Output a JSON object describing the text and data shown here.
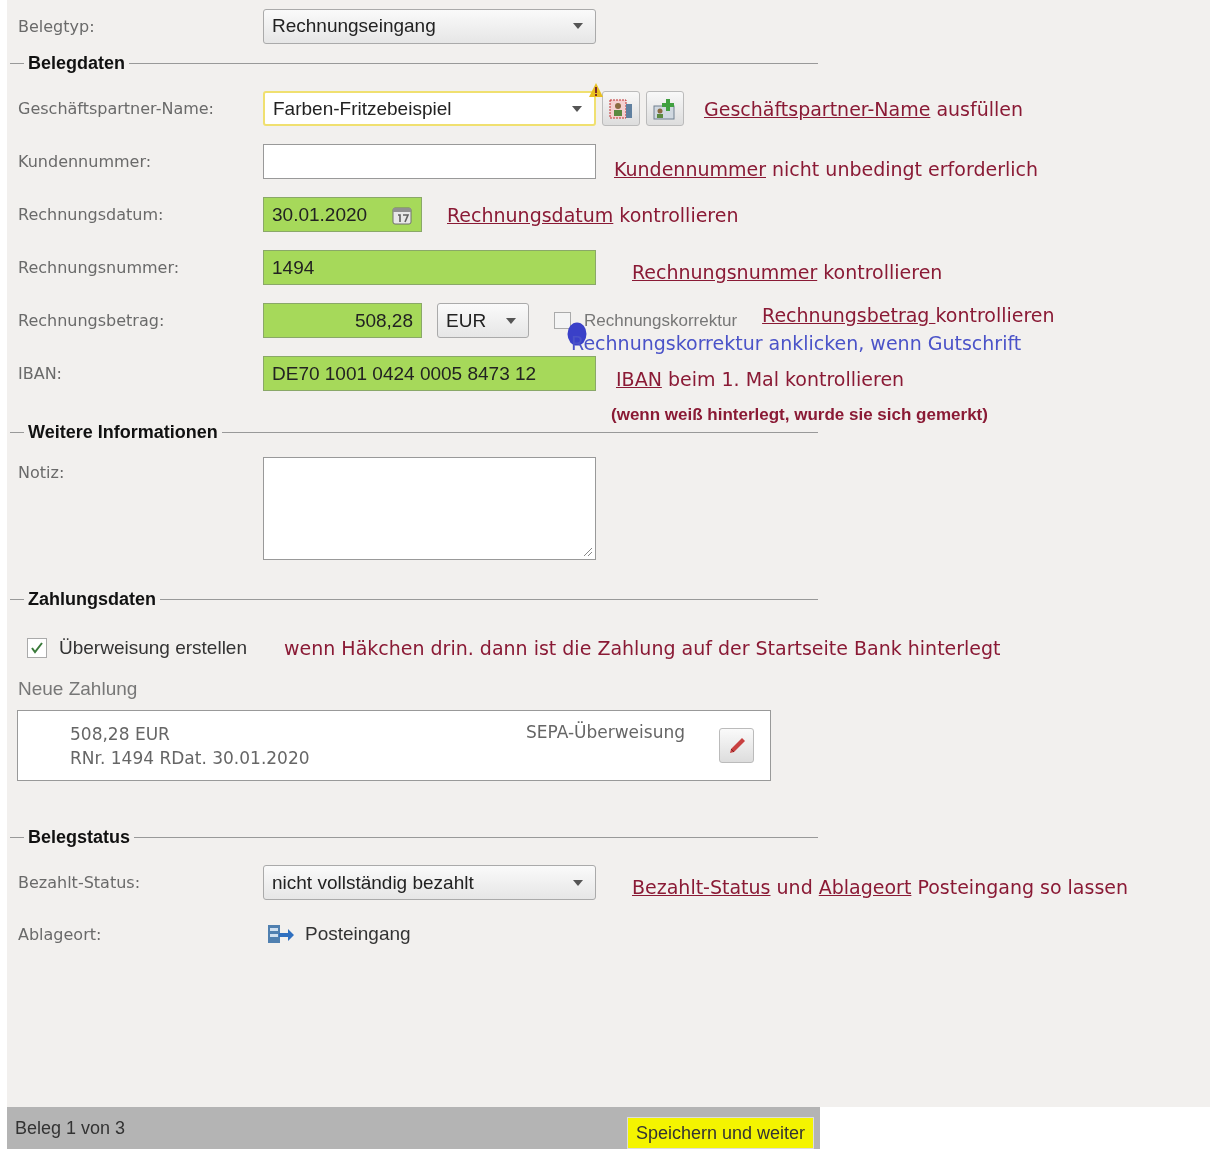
{
  "belegtyp": {
    "label": "Belegtyp:",
    "value": "Rechnungseingang"
  },
  "belegdaten": {
    "title": "Belegdaten",
    "partner": {
      "label": "Geschäftspartner-Name:",
      "value": "Farben-Fritzebeispiel",
      "warning": true,
      "highlighted": false
    },
    "partner_note": {
      "kind": "instruction",
      "segments": [
        {
          "kind": "term",
          "text": "Geschäftspartner-Name"
        },
        {
          "kind": "plain",
          "text": " ausfüllen"
        }
      ]
    },
    "kundennummer": {
      "label": "Kundennummer:",
      "highlighted": false
    },
    "kundennummer_note": {
      "kind": "instruction",
      "segments": [
        {
          "kind": "term",
          "text": "Kundennummer"
        },
        {
          "kind": "plain",
          "text": " nicht unbedingt erforderlich"
        }
      ]
    },
    "datum": {
      "label": "Rechnungsdatum:",
      "value": "30.01.2020",
      "highlighted": true
    },
    "datum_note": {
      "kind": "instruction",
      "segments": [
        {
          "kind": "term",
          "text": "Rechnungsdatum"
        },
        {
          "kind": "plain",
          "text": " kontrollieren"
        }
      ]
    },
    "nummer": {
      "label": "Rechnungsnummer:",
      "value": "1494",
      "highlighted": true
    },
    "nummer_note": {
      "kind": "instruction",
      "segments": [
        {
          "kind": "term",
          "text": "Rechnungsnummer"
        },
        {
          "kind": "plain",
          "text": " kontrollieren"
        }
      ]
    },
    "betrag": {
      "label": "Rechnungsbetrag:",
      "value": "508,28",
      "highlighted": true,
      "currency": "EUR"
    },
    "korrektur": {
      "label": "Rechnungskorrektur",
      "checked": false
    },
    "betrag_notes": [
      {
        "kind": "instruction",
        "segments": [
          {
            "kind": "term",
            "text": "Rechnungsbetrag "
          },
          {
            "kind": "plain",
            "text": "kontrollieren"
          }
        ]
      },
      {
        "kind": "tip",
        "segments": [
          {
            "kind": "plain",
            "text": "Rechnungskorrektur anklicken, wenn Gutschrift"
          }
        ]
      }
    ],
    "iban": {
      "label": "IBAN:",
      "value": "DE70 1001 0424 0005 8473 12",
      "highlighted": true
    },
    "iban_notes": [
      {
        "kind": "instruction",
        "segments": [
          {
            "kind": "term",
            "text": "IBAN"
          },
          {
            "kind": "plain",
            "text": " beim 1. Mal kontrollieren"
          }
        ]
      },
      {
        "kind": "emphasis",
        "segments": [
          {
            "kind": "plain",
            "text": "(wenn weiß hinterlegt, wurde sie sich gemerkt)"
          }
        ]
      }
    ]
  },
  "weitere": {
    "title": "Weitere Informationen",
    "notiz": {
      "label": "Notiz:"
    }
  },
  "zahlungsdaten": {
    "title": "Zahlungsdaten",
    "ueberweisung": {
      "label": "Überweisung erstellen",
      "checked": true
    },
    "ueberweisung_note": {
      "kind": "instruction",
      "segments": [
        {
          "kind": "plain",
          "text": "wenn Häkchen drin. dann ist die Zahlung auf der Startseite Bank hinterlegt"
        }
      ]
    },
    "neue_zahlung": {
      "label": "Neue Zahlung",
      "amount": "508,28 EUR",
      "reference": "RNr. 1494 RDat. 30.01.2020",
      "type": "SEPA-Überweisung"
    }
  },
  "belegstatus": {
    "title": "Belegstatus",
    "bezahlt": {
      "label": "Bezahlt-Status:",
      "value": "nicht vollständig bezahlt"
    },
    "bezahlt_note": {
      "kind": "instruction",
      "segments": [
        {
          "kind": "term",
          "text": "Bezahlt-Status"
        },
        {
          "kind": "plain",
          "text": " und "
        },
        {
          "kind": "term",
          "text": "Ablageort"
        },
        {
          "kind": "plain",
          "text": " Posteingang so lassen"
        }
      ]
    },
    "ablageort": {
      "label": "Ablageort:",
      "value": "Posteingang"
    }
  },
  "footer": {
    "counter": "Beleg 1 von 3",
    "button": "Speichern und weiter"
  }
}
